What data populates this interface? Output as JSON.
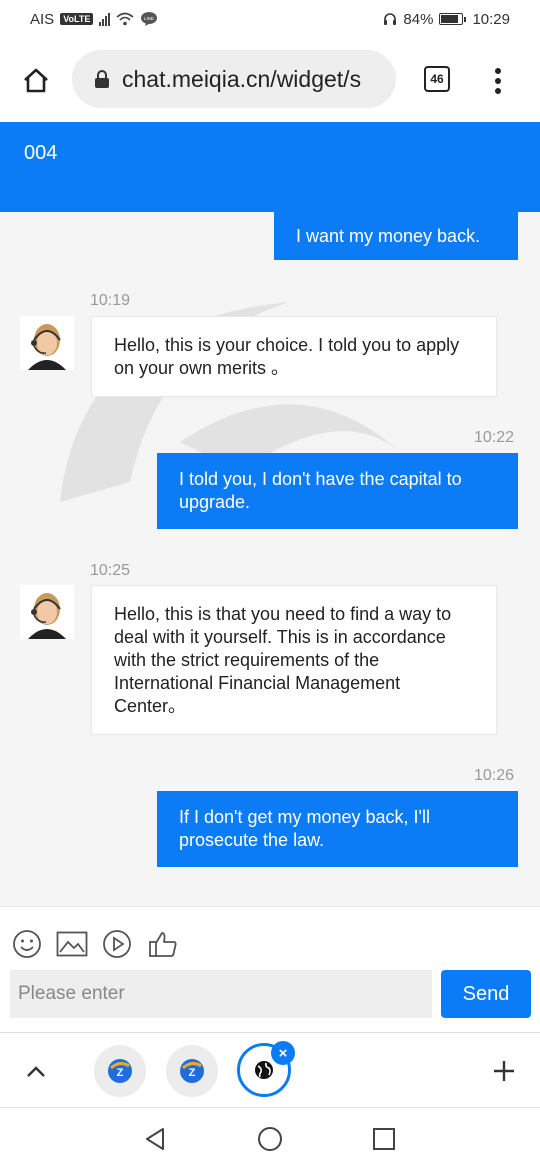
{
  "status_bar": {
    "carrier": "AIS",
    "volte": "VoLTE",
    "line_badge": "LINE",
    "battery": "84%",
    "battery_level": 0.84,
    "time": "10:29"
  },
  "browser": {
    "url": "chat.meiqia.cn/widget/s",
    "tab_count": "46"
  },
  "chat": {
    "title": "004",
    "messages": [
      {
        "from": "visitor",
        "text": "I want my money back."
      },
      {
        "from": "agent",
        "time": "10:19",
        "text": "Hello, this is your choice. I told you to apply on your own merits 。"
      },
      {
        "from": "visitor",
        "time": "10:22",
        "text": "I told you, I don't have the capital to upgrade."
      },
      {
        "from": "agent",
        "time": "10:25",
        "text": "Hello, this is that you need to find a way to deal with it yourself. This is in accordance with the strict requirements of the International Financial Management Center。"
      },
      {
        "from": "visitor",
        "time": "10:26",
        "text": "If I don't get my money back, I'll prosecute the law."
      }
    ]
  },
  "composer": {
    "tools": [
      "emoji-icon",
      "image-icon",
      "video-icon",
      "thumbs-up-icon"
    ],
    "placeholder": "Please enter",
    "send_label": "Send"
  },
  "tab_tray": {
    "tabs": [
      "app-tab-icon",
      "app-tab-icon",
      "globe-icon"
    ],
    "close_label": "×"
  },
  "colors": {
    "accent": "#0b7cf5",
    "background": "#f5f5f5"
  }
}
